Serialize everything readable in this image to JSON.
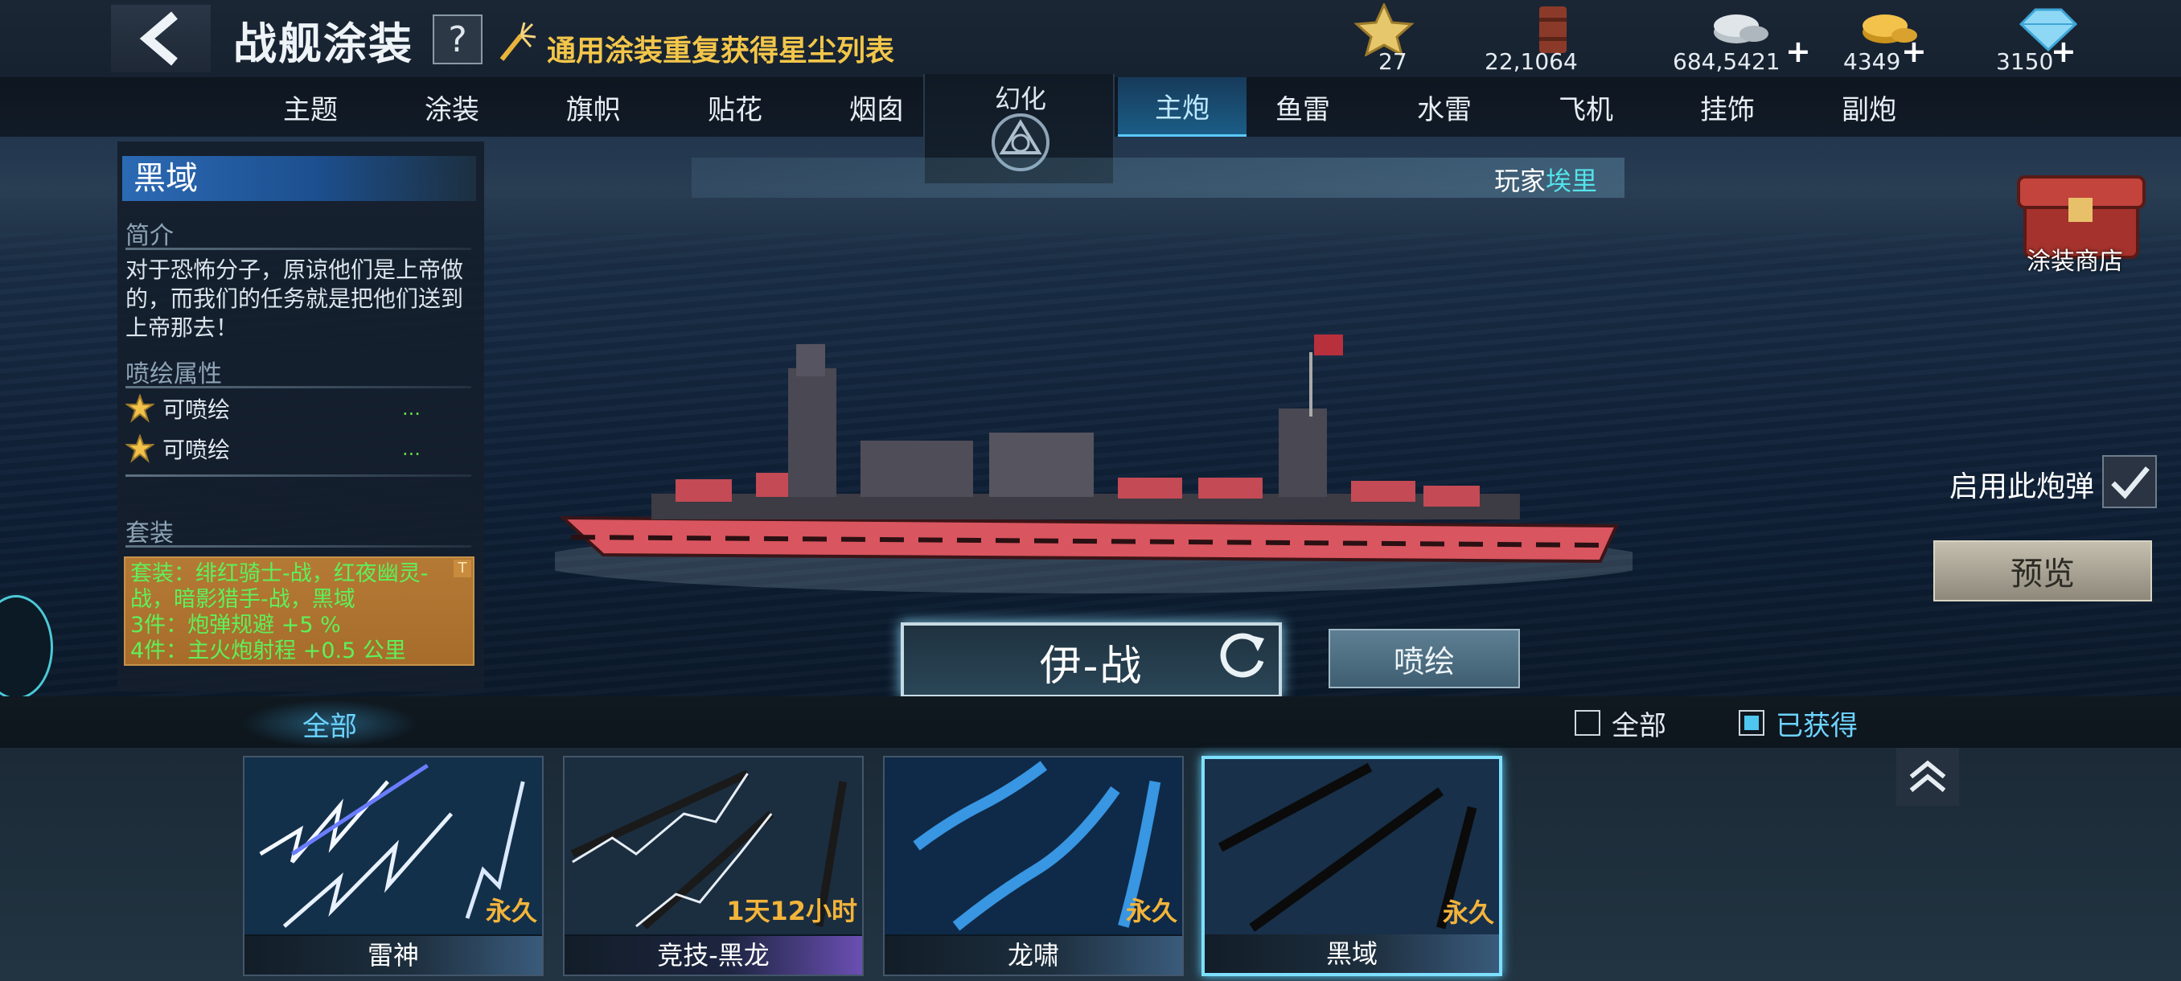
{
  "header": {
    "title": "战舰涂装",
    "help_label": "?",
    "notice": "通用涂装重复获得星尘列表"
  },
  "resources": [
    {
      "name": "star-icon",
      "value": "27",
      "plus": ""
    },
    {
      "name": "oil-barrel-icon",
      "value": "22,1064",
      "plus": ""
    },
    {
      "name": "silver-coins-icon",
      "value": "684,5421",
      "plus": "+"
    },
    {
      "name": "gold-coins-icon",
      "value": "4349",
      "plus": "+"
    },
    {
      "name": "diamond-icon",
      "value": "3150",
      "plus": "+"
    }
  ],
  "tabs": [
    "主题",
    "涂装",
    "旗帜",
    "贴花",
    "烟囱",
    "幻化",
    "主炮",
    "鱼雷",
    "水雷",
    "飞机",
    "挂饰",
    "副炮"
  ],
  "active_tab": "主炮",
  "panel": {
    "name": "黑域",
    "intro_heading": "简介",
    "intro": "对于恐怖分子，原谅他们是上帝做的，而我们的任务就是把他们送到上帝那去！",
    "paint_heading": "喷绘属性",
    "attrs": [
      "可喷绘",
      "可喷绘"
    ],
    "attr_dots": "...",
    "set_heading": "套装",
    "set_lines": [
      "套装：绯红骑士-战，红夜幽灵-战，暗影猎手-战，黑域",
      "3件：炮弹规避  +5 %",
      "4件：主火炮射程  +0.5 公里"
    ],
    "set_badge": "T"
  },
  "player": {
    "prefix": "玩家",
    "name": "埃里"
  },
  "shop_label": "涂装商店",
  "enable_label": "启用此炮弹",
  "preview_label": "预览",
  "ship_name": "伊-战",
  "paint_label": "喷绘",
  "filter": {
    "tab_all": "全部",
    "cb_all": "全部",
    "cb_owned": "已获得"
  },
  "cards": [
    {
      "name": "雷神",
      "duration": "永久",
      "style": "lightning-blue"
    },
    {
      "name": "竞技-黑龙",
      "duration": "1天12小时",
      "style": "lightning-white"
    },
    {
      "name": "龙啸",
      "duration": "永久",
      "style": "lightning-cyan"
    },
    {
      "name": "黑域",
      "duration": "永久",
      "style": "dark"
    }
  ],
  "colors": {
    "accent": "#5cc9ff",
    "gold": "#f3b43a",
    "ship_hull": "#d9555f"
  }
}
